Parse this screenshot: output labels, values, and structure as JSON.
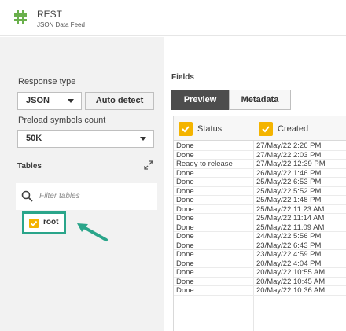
{
  "header": {
    "title": "REST",
    "subtitle": "JSON Data Feed"
  },
  "response_type": {
    "label": "Response type",
    "value": "JSON",
    "auto_detect": "Auto detect"
  },
  "preload": {
    "label": "Preload symbols count",
    "value": "50K"
  },
  "tables": {
    "label": "Tables",
    "filter_placeholder": "Filter tables",
    "items": [
      {
        "label": "root",
        "checked": true
      }
    ]
  },
  "fields": {
    "label": "Fields",
    "tabs": {
      "preview": "Preview",
      "metadata": "Metadata"
    },
    "columns": {
      "status": "Status",
      "created": "Created"
    },
    "rows": [
      {
        "status": "Done",
        "created": "27/May/22 2:26 PM"
      },
      {
        "status": "Done",
        "created": "27/May/22 2:03 PM"
      },
      {
        "status": "Ready to release",
        "created": "27/May/22 12:39 PM"
      },
      {
        "status": "Done",
        "created": "26/May/22 1:46 PM"
      },
      {
        "status": "Done",
        "created": "25/May/22 6:53 PM"
      },
      {
        "status": "Done",
        "created": "25/May/22 5:52 PM"
      },
      {
        "status": "Done",
        "created": "25/May/22 1:48 PM"
      },
      {
        "status": "Done",
        "created": "25/May/22 11:23 AM"
      },
      {
        "status": "Done",
        "created": "25/May/22 11:14 AM"
      },
      {
        "status": "Done",
        "created": "25/May/22 11:09 AM"
      },
      {
        "status": "Done",
        "created": "24/May/22 5:56 PM"
      },
      {
        "status": "Done",
        "created": "23/May/22 6:43 PM"
      },
      {
        "status": "Done",
        "created": "23/May/22 4:59 PM"
      },
      {
        "status": "Done",
        "created": "20/May/22 4:04 PM"
      },
      {
        "status": "Done",
        "created": "20/May/22 10:55 AM"
      },
      {
        "status": "Done",
        "created": "20/May/22 10:45 AM"
      },
      {
        "status": "Done",
        "created": "20/May/22 10:36 AM"
      }
    ]
  },
  "colors": {
    "accent_checkbox": "#f4b400",
    "highlight": "#2aa58a",
    "tab_active": "#4d4d4d"
  }
}
